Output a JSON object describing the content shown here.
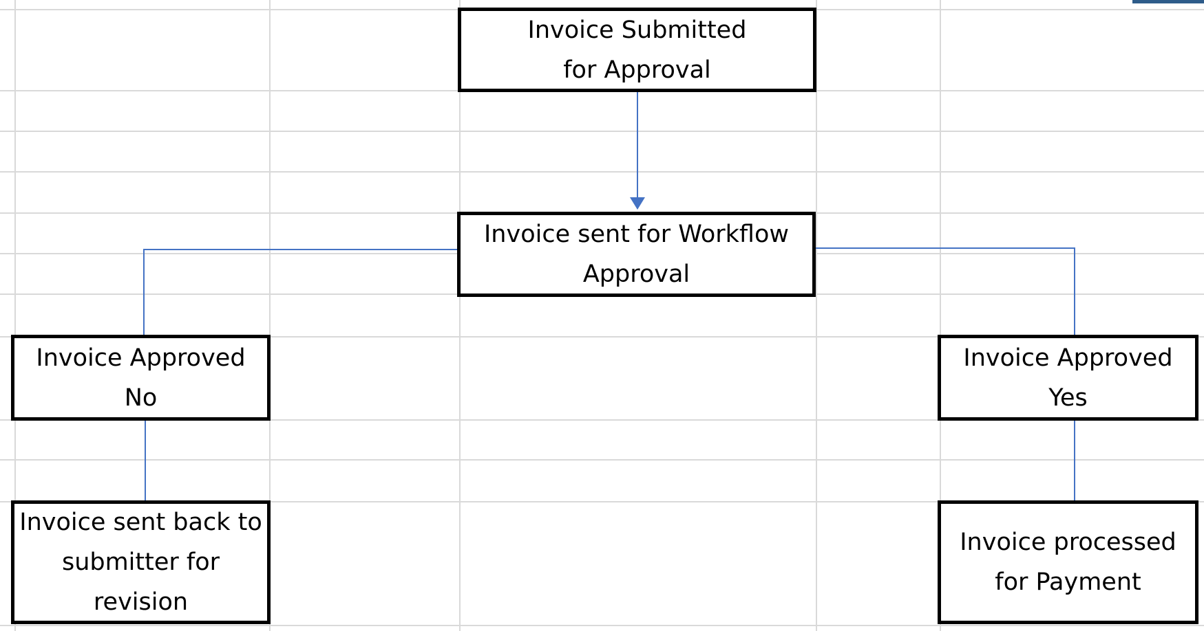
{
  "diagram": {
    "nodes": {
      "submitted": {
        "lines": [
          "Invoice Submitted",
          "for Approval"
        ]
      },
      "workflow": {
        "lines": [
          "Invoice sent for Workflow",
          "Approval"
        ]
      },
      "no": {
        "lines": [
          "Invoice Approved",
          "No"
        ]
      },
      "yes": {
        "lines": [
          "Invoice Approved",
          "Yes"
        ]
      },
      "revision": {
        "lines": [
          "Invoice sent back to",
          "submitter for",
          "revision"
        ]
      },
      "payment": {
        "lines": [
          "Invoice processed",
          "for Payment"
        ]
      }
    },
    "edges": [
      {
        "from": "submitted",
        "to": "workflow",
        "arrow": true
      },
      {
        "from": "workflow",
        "to": "no",
        "arrow": false
      },
      {
        "from": "workflow",
        "to": "yes",
        "arrow": false
      },
      {
        "from": "no",
        "to": "revision",
        "arrow": false
      },
      {
        "from": "yes",
        "to": "payment",
        "arrow": false
      }
    ]
  },
  "colors": {
    "gridline": "#d9d9d9",
    "connector": "#4472c4",
    "box_border": "#000000",
    "corner_tab": "#2e5c8a"
  }
}
